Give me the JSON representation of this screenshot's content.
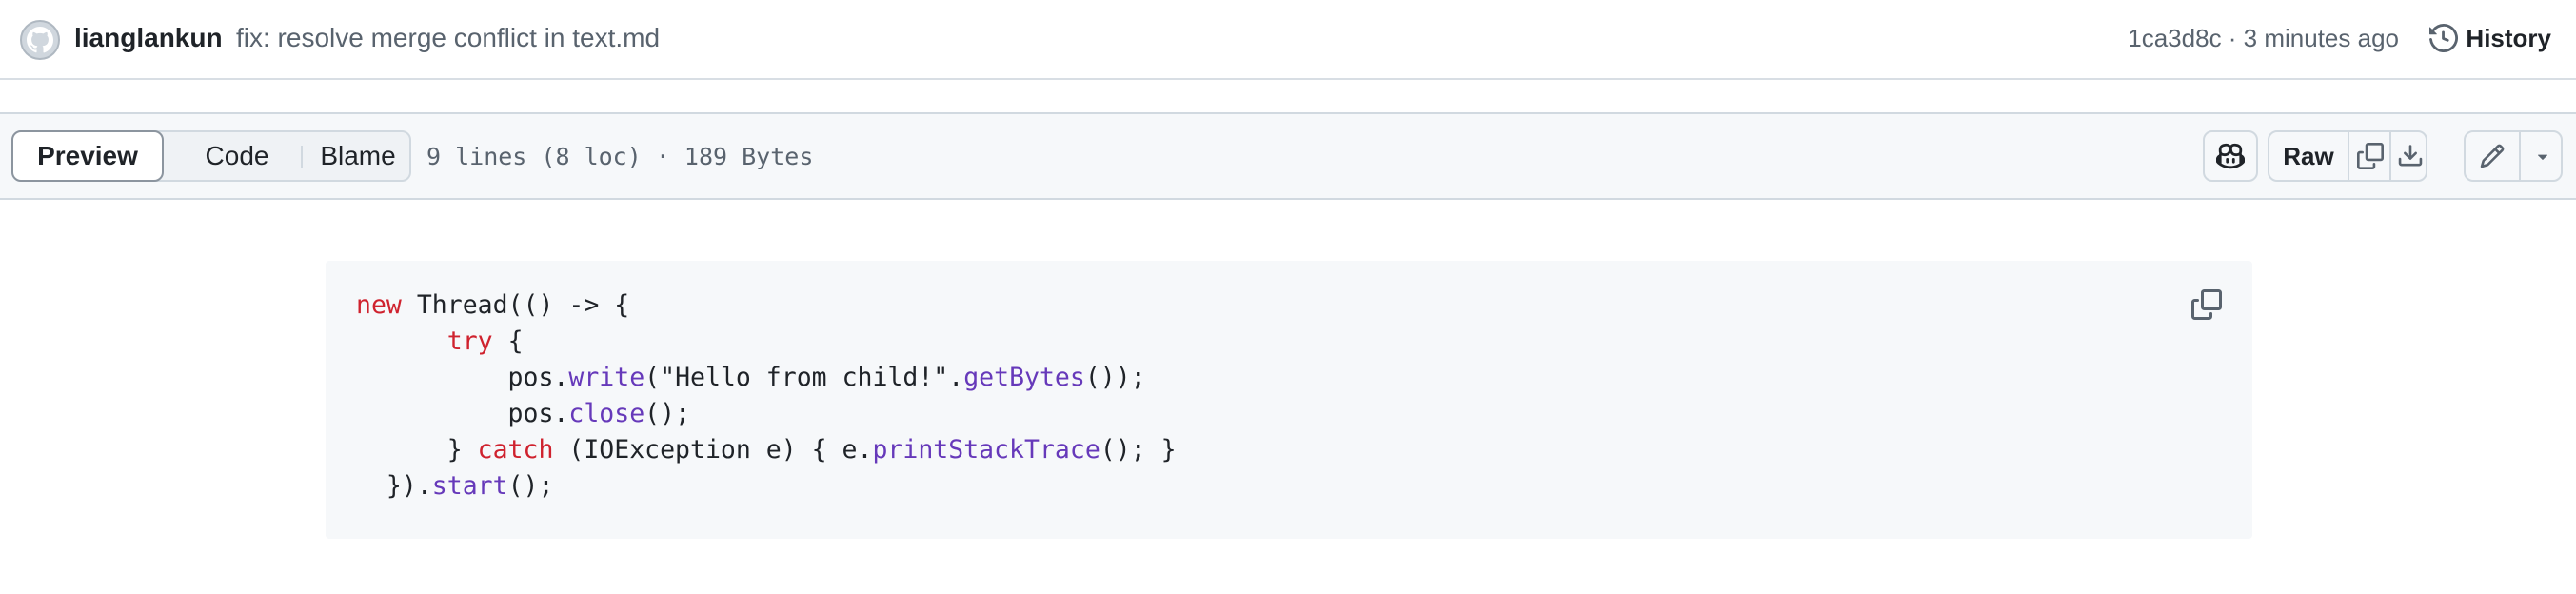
{
  "commit": {
    "author": "lianglankun",
    "message": "fix: resolve merge conflict in text.md",
    "sha_time": "1ca3d8c · 3 minutes ago",
    "history_label": "History"
  },
  "toolbar": {
    "tabs": [
      "Preview",
      "Code",
      "Blame"
    ],
    "active_tab": "Preview",
    "file_info": "9 lines (8 loc) · 189 Bytes",
    "raw_label": "Raw"
  },
  "code": {
    "lines": [
      [
        {
          "t": "new",
          "c": "kw"
        },
        {
          "t": " Thread(() -> {"
        }
      ],
      [
        {
          "t": "      "
        },
        {
          "t": "try",
          "c": "kw"
        },
        {
          "t": " {"
        }
      ],
      [
        {
          "t": "          pos."
        },
        {
          "t": "write",
          "c": "fn"
        },
        {
          "t": "(\"Hello from child!\"."
        },
        {
          "t": "getBytes",
          "c": "fn"
        },
        {
          "t": "());"
        }
      ],
      [
        {
          "t": "          pos."
        },
        {
          "t": "close",
          "c": "fn"
        },
        {
          "t": "();"
        }
      ],
      [
        {
          "t": "      } "
        },
        {
          "t": "catch",
          "c": "kw"
        },
        {
          "t": " (IOException e) { e."
        },
        {
          "t": "printStackTrace",
          "c": "fn"
        },
        {
          "t": "(); }"
        }
      ],
      [
        {
          "t": "  })."
        },
        {
          "t": "start",
          "c": "fn"
        },
        {
          "t": "();"
        }
      ]
    ]
  },
  "icons": {
    "avatar": "github-avatar-icon",
    "history": "history-clock-icon",
    "copilot": "copilot-icon",
    "copy": "copy-icon",
    "download": "download-icon",
    "edit": "pencil-icon",
    "caret": "triangle-down-icon"
  },
  "colors": {
    "keyword": "#cf222e",
    "function": "#6639ba",
    "string": "#0a3069",
    "code_bg": "#f6f8fa"
  }
}
